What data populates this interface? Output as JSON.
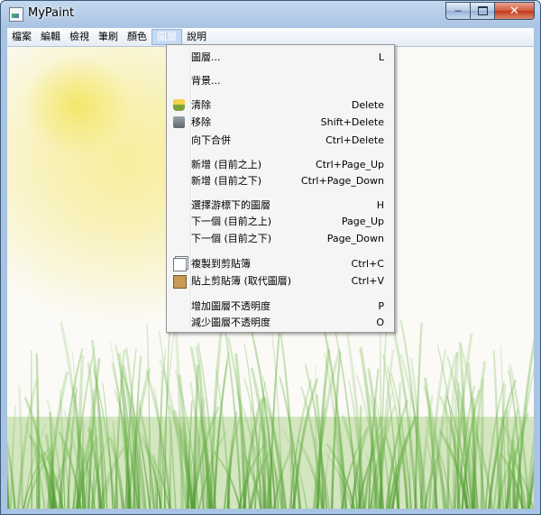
{
  "window": {
    "title": "MyPaint",
    "minimize_glyph": "─",
    "close_glyph": "✕"
  },
  "menubar": {
    "items": [
      {
        "label": "檔案"
      },
      {
        "label": "編輯"
      },
      {
        "label": "檢視"
      },
      {
        "label": "筆刷"
      },
      {
        "label": "顏色"
      },
      {
        "label": "圖層",
        "active": true
      },
      {
        "label": "說明"
      }
    ]
  },
  "layer_menu": {
    "items": [
      {
        "label": "圖層...",
        "shortcut": "L"
      },
      {
        "label": "背景...",
        "shortcut": ""
      },
      {
        "label": "清除",
        "shortcut": "Delete",
        "icon": "broom-icon"
      },
      {
        "label": "移除",
        "shortcut": "Shift+Delete",
        "icon": "trash-icon"
      },
      {
        "label": "向下合併",
        "shortcut": "Ctrl+Delete"
      },
      {
        "label": "新增 (目前之上)",
        "shortcut": "Ctrl+Page_Up"
      },
      {
        "label": "新增 (目前之下)",
        "shortcut": "Ctrl+Page_Down"
      },
      {
        "label": "選擇游標下的圖層",
        "shortcut": "H"
      },
      {
        "label": "下一個 (目前之上)",
        "shortcut": "Page_Up"
      },
      {
        "label": "下一個 (目前之下)",
        "shortcut": "Page_Down"
      },
      {
        "label": "複製到剪貼簿",
        "shortcut": "Ctrl+C",
        "icon": "copy-icon"
      },
      {
        "label": "貼上剪貼簿 (取代圖層)",
        "shortcut": "Ctrl+V",
        "icon": "paste-icon"
      },
      {
        "label": "增加圖層不透明度",
        "shortcut": "P"
      },
      {
        "label": "減少圖層不透明度",
        "shortcut": "O"
      }
    ]
  },
  "canvas": {
    "sun_color": "#f3e76a",
    "grass_color": "#5aa83a"
  }
}
